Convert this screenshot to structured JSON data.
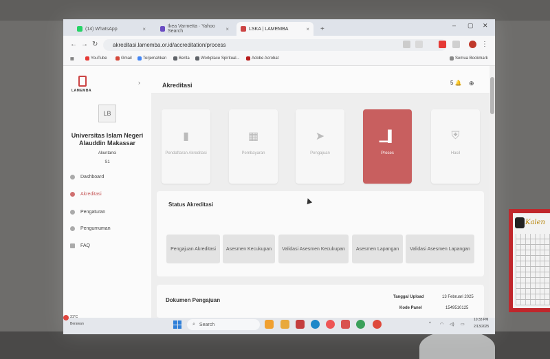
{
  "browser": {
    "tabs": [
      {
        "label": "(14) WhatsApp"
      },
      {
        "label": "Ikea Varmetta · Yahoo Search"
      },
      {
        "label": "LSKA | LAMEMBA"
      }
    ],
    "url": "akreditasi.lamemba.or.id/accreditation/process",
    "bookmarks": [
      {
        "label": "YouTube",
        "color": "#e53935"
      },
      {
        "label": "Gmail",
        "color": "#d44638"
      },
      {
        "label": "Terjemahkan",
        "color": "#4285f4"
      },
      {
        "label": "Berita",
        "color": "#5f6368"
      },
      {
        "label": "Workplace Spiritual...",
        "color": "#5f6368"
      },
      {
        "label": "Adobe Acrobat",
        "color": "#5f6368"
      }
    ],
    "all_bookmarks_label": "Semua Bookmark"
  },
  "app": {
    "logo_text": "LAMEMBA",
    "page_title": "Akreditasi",
    "notification_count": "5",
    "accent_color": "#c85f5f"
  },
  "profile": {
    "initials": "LB",
    "university": "Universitas Islam Negeri Alauddin Makassar",
    "program": "Akuntansi",
    "level": "S1"
  },
  "sidebar": {
    "items": [
      {
        "label": "Dashboard",
        "active": false
      },
      {
        "label": "Akreditasi",
        "active": true
      },
      {
        "label": "Pengaturan",
        "active": false
      },
      {
        "label": "Pengumuman",
        "active": false
      },
      {
        "label": "FAQ",
        "active": false
      }
    ]
  },
  "steps": [
    {
      "label": "Pendaftaran Akreditasi",
      "active": false
    },
    {
      "label": "Pembayaran",
      "active": false
    },
    {
      "label": "Pengajuan",
      "active": false
    },
    {
      "label": "Proses",
      "active": true
    },
    {
      "label": "Hasil",
      "active": false
    }
  ],
  "status": {
    "title": "Status Akreditasi",
    "items": [
      {
        "label": "Pengajuan Akreditasi"
      },
      {
        "label": "Asesmen Kecukupan"
      },
      {
        "label": "Validasi Asesmen Kecukupan"
      },
      {
        "label": "Asesmen Lapangan"
      },
      {
        "label": "Validasi Asesmen Lapangan"
      }
    ]
  },
  "dokumen": {
    "title": "Dokumen Pengajuan",
    "upload_label": "Tanggal Upload",
    "upload_value": "13 Februari 2025",
    "panel_label": "Kode Panel",
    "panel_value": "1549510125"
  },
  "taskbar": {
    "weather_temp": "31°C",
    "weather_desc": "Berawan",
    "search_placeholder": "Search",
    "time": "10:33 PM",
    "date": "2/13/2025"
  },
  "calendar": {
    "title": "Kalen"
  }
}
